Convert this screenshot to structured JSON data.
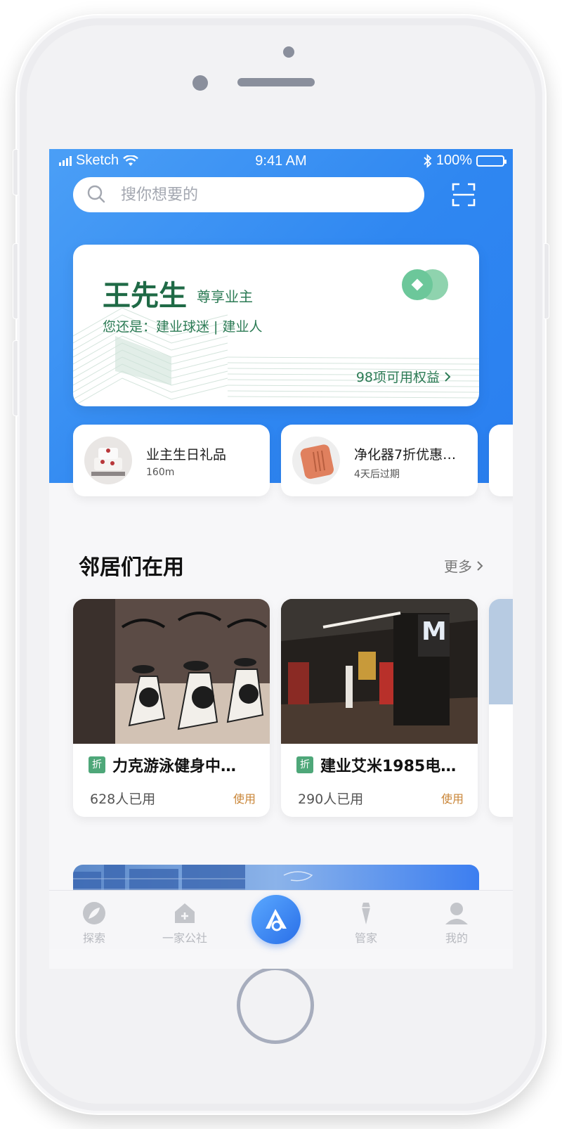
{
  "status_bar": {
    "carrier": "Sketch",
    "time": "9:41 AM",
    "battery": "100%"
  },
  "search": {
    "placeholder": "搜你想要的"
  },
  "member_card": {
    "name": "王先生",
    "tag": "尊享业主",
    "identity_line": "您还是：建业球迷 | 建业人",
    "rights": "98项可用权益"
  },
  "coupons": [
    {
      "title": "业主生日礼品",
      "meta": "160m"
    },
    {
      "title": "净化器7折优惠…",
      "meta": "4天后过期"
    }
  ],
  "section": {
    "title": "邻居们在用",
    "more": "更多"
  },
  "places": [
    {
      "badge": "折",
      "name": "力克游泳健身中…",
      "used": "628人已用",
      "action": "使用"
    },
    {
      "badge": "折",
      "name": "建业艾米1985电…",
      "used": "290人已用",
      "action": "使用"
    }
  ],
  "tabbar": {
    "items": [
      {
        "label": "探索",
        "icon": "explore-icon"
      },
      {
        "label": "一家公社",
        "icon": "home-plus-icon"
      },
      {
        "label": "",
        "icon": "brand-logo-icon"
      },
      {
        "label": "管家",
        "icon": "butler-icon"
      },
      {
        "label": "我的",
        "icon": "profile-icon"
      }
    ]
  },
  "colors": {
    "primary_blue": "#2f87f1",
    "card_green": "#2c7b55",
    "use_orange": "#c98537",
    "tab_inactive": "#b7b9bf"
  }
}
